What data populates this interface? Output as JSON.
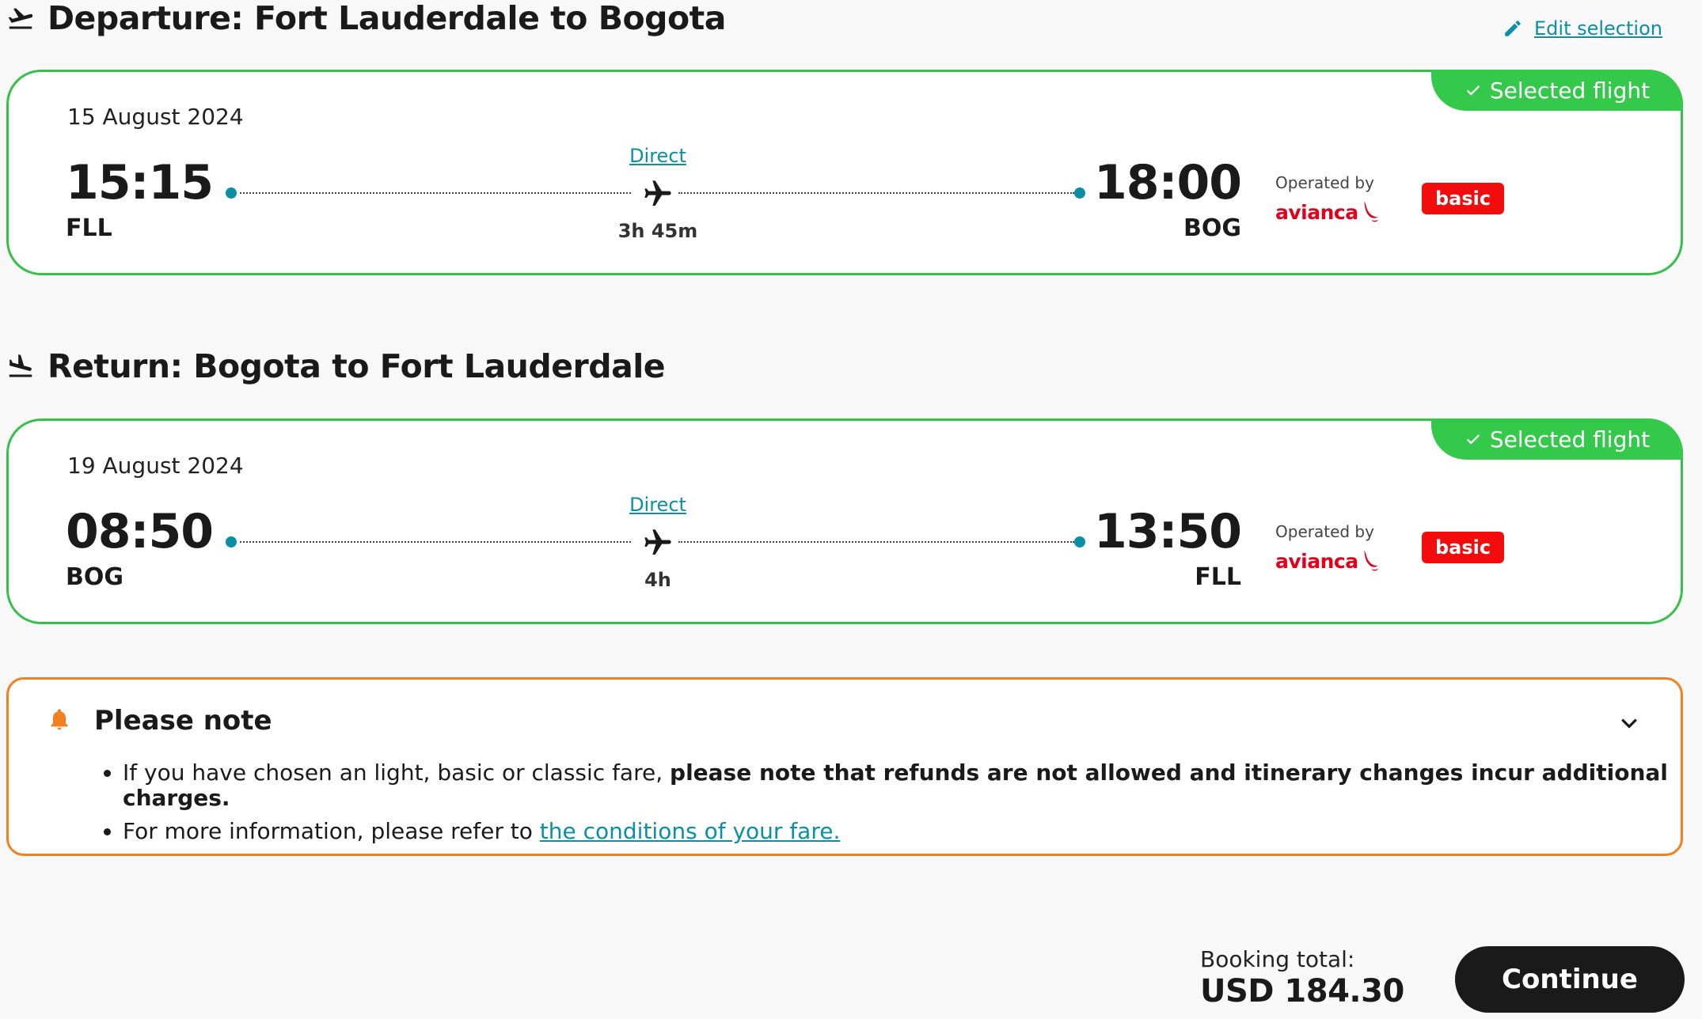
{
  "edit_selection": "Edit selection",
  "selected_label": "Selected flight",
  "operated_by": "Operated by",
  "airline": "avianca",
  "departure": {
    "title": "Departure: Fort Lauderdale to Bogota",
    "date": "15 August 2024",
    "dep_time": "15:15",
    "dep_code": "FLL",
    "arr_time": "18:00",
    "arr_code": "BOG",
    "stops": "Direct",
    "duration": "3h 45m",
    "fare": "basic"
  },
  "return": {
    "title": "Return: Bogota to Fort Lauderdale",
    "date": "19 August 2024",
    "dep_time": "08:50",
    "dep_code": "BOG",
    "arr_time": "13:50",
    "arr_code": "FLL",
    "stops": "Direct",
    "duration": "4h",
    "fare": "basic"
  },
  "note": {
    "title": "Please note",
    "item1_plain": "If you have chosen an light, basic or classic fare, ",
    "item1_bold": "please note that refunds are not allowed and itinerary changes incur additional charges.",
    "item2_plain": "For more information, please refer to ",
    "item2_link": "the conditions of your fare."
  },
  "total": {
    "label": "Booking total:",
    "value": "USD 184.30"
  },
  "continue_label": "Continue",
  "colors": {
    "accent": "#0a8fa6",
    "selected_green": "#35c94c",
    "fare_red": "#f20c0c",
    "note_orange": "#f2801f"
  }
}
